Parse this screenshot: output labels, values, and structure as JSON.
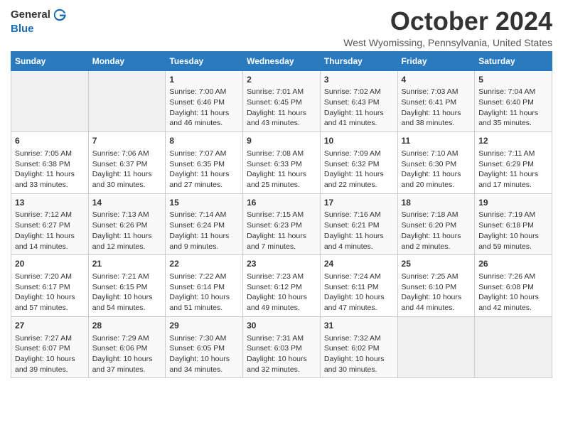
{
  "logo": {
    "line1": "General",
    "line2": "Blue"
  },
  "title": "October 2024",
  "location": "West Wyomissing, Pennsylvania, United States",
  "days_of_week": [
    "Sunday",
    "Monday",
    "Tuesday",
    "Wednesday",
    "Thursday",
    "Friday",
    "Saturday"
  ],
  "weeks": [
    [
      {
        "day": "",
        "sunrise": "",
        "sunset": "",
        "daylight": ""
      },
      {
        "day": "",
        "sunrise": "",
        "sunset": "",
        "daylight": ""
      },
      {
        "day": "1",
        "sunrise": "Sunrise: 7:00 AM",
        "sunset": "Sunset: 6:46 PM",
        "daylight": "Daylight: 11 hours and 46 minutes."
      },
      {
        "day": "2",
        "sunrise": "Sunrise: 7:01 AM",
        "sunset": "Sunset: 6:45 PM",
        "daylight": "Daylight: 11 hours and 43 minutes."
      },
      {
        "day": "3",
        "sunrise": "Sunrise: 7:02 AM",
        "sunset": "Sunset: 6:43 PM",
        "daylight": "Daylight: 11 hours and 41 minutes."
      },
      {
        "day": "4",
        "sunrise": "Sunrise: 7:03 AM",
        "sunset": "Sunset: 6:41 PM",
        "daylight": "Daylight: 11 hours and 38 minutes."
      },
      {
        "day": "5",
        "sunrise": "Sunrise: 7:04 AM",
        "sunset": "Sunset: 6:40 PM",
        "daylight": "Daylight: 11 hours and 35 minutes."
      }
    ],
    [
      {
        "day": "6",
        "sunrise": "Sunrise: 7:05 AM",
        "sunset": "Sunset: 6:38 PM",
        "daylight": "Daylight: 11 hours and 33 minutes."
      },
      {
        "day": "7",
        "sunrise": "Sunrise: 7:06 AM",
        "sunset": "Sunset: 6:37 PM",
        "daylight": "Daylight: 11 hours and 30 minutes."
      },
      {
        "day": "8",
        "sunrise": "Sunrise: 7:07 AM",
        "sunset": "Sunset: 6:35 PM",
        "daylight": "Daylight: 11 hours and 27 minutes."
      },
      {
        "day": "9",
        "sunrise": "Sunrise: 7:08 AM",
        "sunset": "Sunset: 6:33 PM",
        "daylight": "Daylight: 11 hours and 25 minutes."
      },
      {
        "day": "10",
        "sunrise": "Sunrise: 7:09 AM",
        "sunset": "Sunset: 6:32 PM",
        "daylight": "Daylight: 11 hours and 22 minutes."
      },
      {
        "day": "11",
        "sunrise": "Sunrise: 7:10 AM",
        "sunset": "Sunset: 6:30 PM",
        "daylight": "Daylight: 11 hours and 20 minutes."
      },
      {
        "day": "12",
        "sunrise": "Sunrise: 7:11 AM",
        "sunset": "Sunset: 6:29 PM",
        "daylight": "Daylight: 11 hours and 17 minutes."
      }
    ],
    [
      {
        "day": "13",
        "sunrise": "Sunrise: 7:12 AM",
        "sunset": "Sunset: 6:27 PM",
        "daylight": "Daylight: 11 hours and 14 minutes."
      },
      {
        "day": "14",
        "sunrise": "Sunrise: 7:13 AM",
        "sunset": "Sunset: 6:26 PM",
        "daylight": "Daylight: 11 hours and 12 minutes."
      },
      {
        "day": "15",
        "sunrise": "Sunrise: 7:14 AM",
        "sunset": "Sunset: 6:24 PM",
        "daylight": "Daylight: 11 hours and 9 minutes."
      },
      {
        "day": "16",
        "sunrise": "Sunrise: 7:15 AM",
        "sunset": "Sunset: 6:23 PM",
        "daylight": "Daylight: 11 hours and 7 minutes."
      },
      {
        "day": "17",
        "sunrise": "Sunrise: 7:16 AM",
        "sunset": "Sunset: 6:21 PM",
        "daylight": "Daylight: 11 hours and 4 minutes."
      },
      {
        "day": "18",
        "sunrise": "Sunrise: 7:18 AM",
        "sunset": "Sunset: 6:20 PM",
        "daylight": "Daylight: 11 hours and 2 minutes."
      },
      {
        "day": "19",
        "sunrise": "Sunrise: 7:19 AM",
        "sunset": "Sunset: 6:18 PM",
        "daylight": "Daylight: 10 hours and 59 minutes."
      }
    ],
    [
      {
        "day": "20",
        "sunrise": "Sunrise: 7:20 AM",
        "sunset": "Sunset: 6:17 PM",
        "daylight": "Daylight: 10 hours and 57 minutes."
      },
      {
        "day": "21",
        "sunrise": "Sunrise: 7:21 AM",
        "sunset": "Sunset: 6:15 PM",
        "daylight": "Daylight: 10 hours and 54 minutes."
      },
      {
        "day": "22",
        "sunrise": "Sunrise: 7:22 AM",
        "sunset": "Sunset: 6:14 PM",
        "daylight": "Daylight: 10 hours and 51 minutes."
      },
      {
        "day": "23",
        "sunrise": "Sunrise: 7:23 AM",
        "sunset": "Sunset: 6:12 PM",
        "daylight": "Daylight: 10 hours and 49 minutes."
      },
      {
        "day": "24",
        "sunrise": "Sunrise: 7:24 AM",
        "sunset": "Sunset: 6:11 PM",
        "daylight": "Daylight: 10 hours and 47 minutes."
      },
      {
        "day": "25",
        "sunrise": "Sunrise: 7:25 AM",
        "sunset": "Sunset: 6:10 PM",
        "daylight": "Daylight: 10 hours and 44 minutes."
      },
      {
        "day": "26",
        "sunrise": "Sunrise: 7:26 AM",
        "sunset": "Sunset: 6:08 PM",
        "daylight": "Daylight: 10 hours and 42 minutes."
      }
    ],
    [
      {
        "day": "27",
        "sunrise": "Sunrise: 7:27 AM",
        "sunset": "Sunset: 6:07 PM",
        "daylight": "Daylight: 10 hours and 39 minutes."
      },
      {
        "day": "28",
        "sunrise": "Sunrise: 7:29 AM",
        "sunset": "Sunset: 6:06 PM",
        "daylight": "Daylight: 10 hours and 37 minutes."
      },
      {
        "day": "29",
        "sunrise": "Sunrise: 7:30 AM",
        "sunset": "Sunset: 6:05 PM",
        "daylight": "Daylight: 10 hours and 34 minutes."
      },
      {
        "day": "30",
        "sunrise": "Sunrise: 7:31 AM",
        "sunset": "Sunset: 6:03 PM",
        "daylight": "Daylight: 10 hours and 32 minutes."
      },
      {
        "day": "31",
        "sunrise": "Sunrise: 7:32 AM",
        "sunset": "Sunset: 6:02 PM",
        "daylight": "Daylight: 10 hours and 30 minutes."
      },
      {
        "day": "",
        "sunrise": "",
        "sunset": "",
        "daylight": ""
      },
      {
        "day": "",
        "sunrise": "",
        "sunset": "",
        "daylight": ""
      }
    ]
  ]
}
